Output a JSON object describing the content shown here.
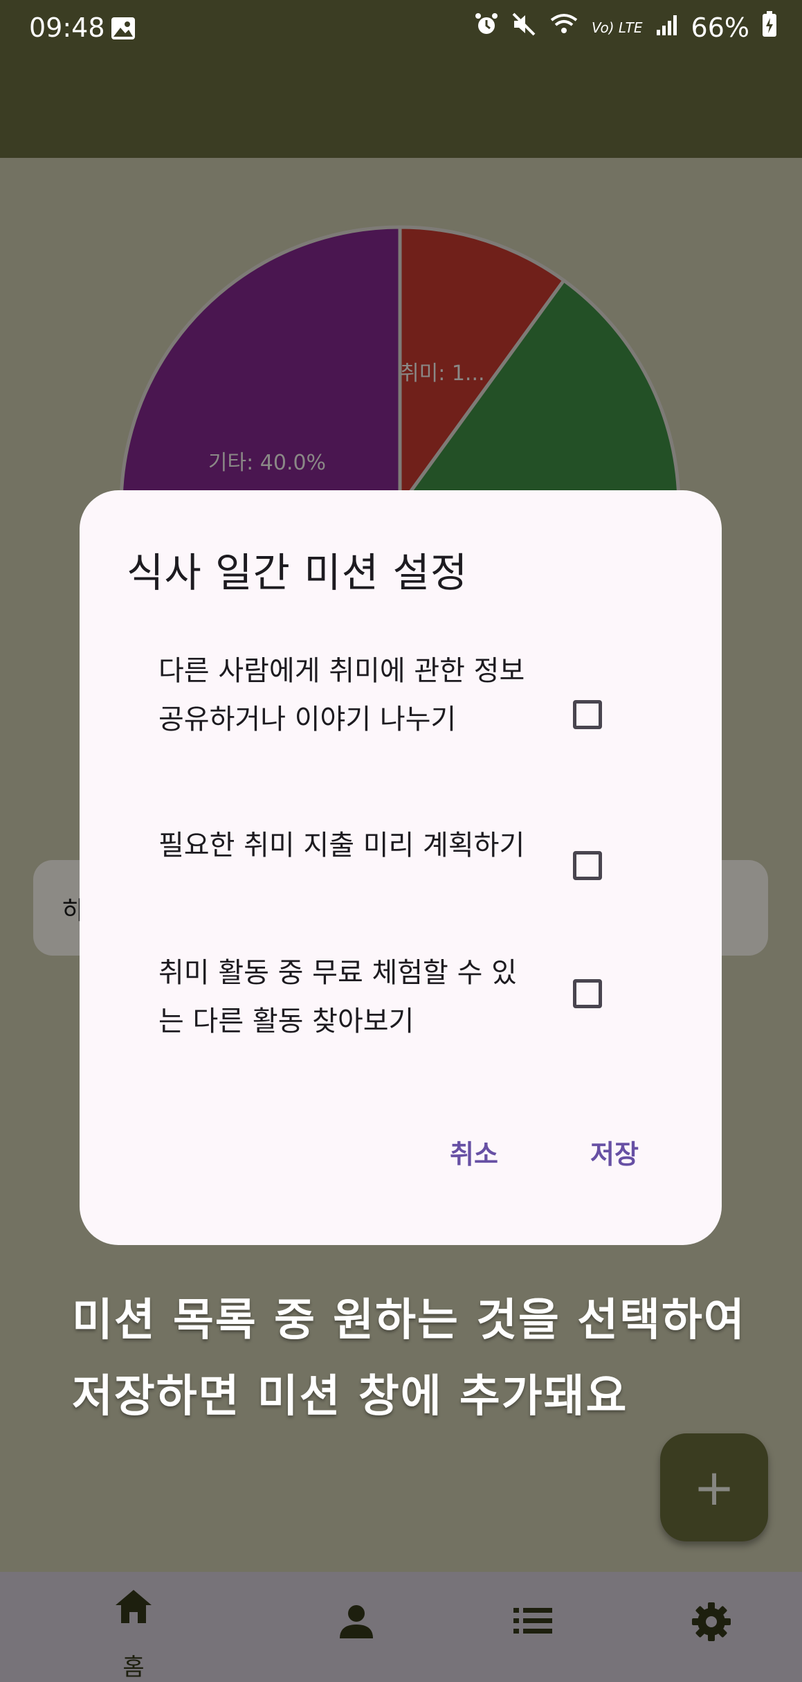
{
  "status_bar": {
    "time": "09:48",
    "network": "Vo) LTE",
    "battery": "66%",
    "icons": [
      "image-icon",
      "alarm-icon",
      "mute-icon",
      "wifi-icon",
      "signal-icon",
      "battery-icon"
    ]
  },
  "chart_data": {
    "type": "pie",
    "slices": [
      {
        "label": "기타",
        "value": 40.0,
        "display": "기타: 40.0%",
        "color": "#4a1650"
      },
      {
        "label": "취미",
        "value": 10.0,
        "display": "취미: 1...",
        "color": "#70201a"
      },
      {
        "label": "",
        "value": 15.0,
        "display": "",
        "color": "#235026"
      }
    ],
    "note": "Remaining slices hidden behind dialog"
  },
  "background_card": {
    "text": "하"
  },
  "dialog": {
    "title": "식사 일간 미션 설정",
    "missions": [
      {
        "label": "다른 사람에게 취미에 관한 정보 공유하거나 이야기 나누기",
        "checked": false
      },
      {
        "label": "필요한 취미 지출 미리 계획하기",
        "checked": false
      },
      {
        "label": "취미 활동 중 무료 체험할 수 있는 다른 활동 찾아보기",
        "checked": false
      }
    ],
    "cancel_label": "취소",
    "save_label": "저장"
  },
  "caption": {
    "line1": "미션 목록 중 원하는 것을 선택하여",
    "line2": "저장하면 미션 창에 추가돼요"
  },
  "fab": {
    "label": "+"
  },
  "bottom_nav": {
    "items": [
      {
        "icon": "home-icon",
        "label": "홈",
        "active": true
      },
      {
        "icon": "person-icon",
        "label": ""
      },
      {
        "icon": "list-icon",
        "label": ""
      },
      {
        "icon": "gear-icon",
        "label": ""
      }
    ]
  },
  "colors": {
    "top_bar": "#3b3d23",
    "scrim_background": "#737262",
    "dialog_bg": "#fdf7fb",
    "accent": "#6750a4",
    "fab": "#3a3c20",
    "bottom_nav": "#777379"
  }
}
